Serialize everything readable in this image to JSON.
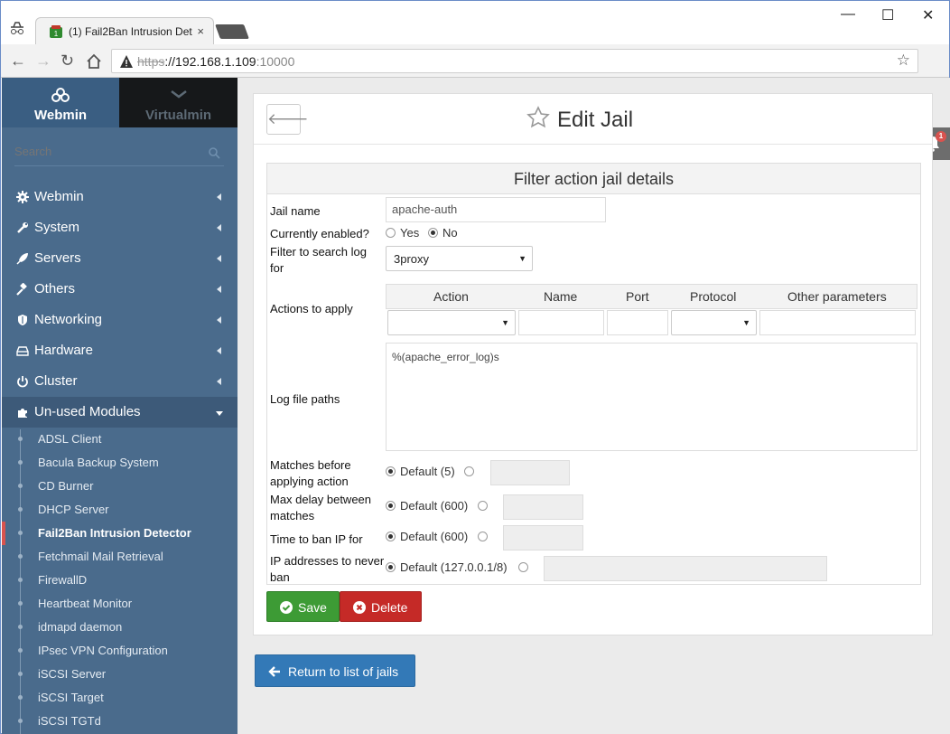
{
  "browser": {
    "tab_title": "(1) Fail2Ban Intrusion Det",
    "tab_close": "×",
    "url_struck": "https",
    "url_host": "://192.168.1.109",
    "url_port": ":10000"
  },
  "sidebar": {
    "tabs": [
      {
        "label": "Webmin"
      },
      {
        "label": "Virtualmin"
      }
    ],
    "search_placeholder": "Search",
    "categories": [
      {
        "label": "Webmin"
      },
      {
        "label": "System"
      },
      {
        "label": "Servers"
      },
      {
        "label": "Others"
      },
      {
        "label": "Networking"
      },
      {
        "label": "Hardware"
      },
      {
        "label": "Cluster"
      },
      {
        "label": "Un-used Modules"
      }
    ],
    "modules": [
      {
        "label": "ADSL Client"
      },
      {
        "label": "Bacula Backup System"
      },
      {
        "label": "CD Burner"
      },
      {
        "label": "DHCP Server"
      },
      {
        "label": "Fail2Ban Intrusion Detector"
      },
      {
        "label": "Fetchmail Mail Retrieval"
      },
      {
        "label": "FirewallD"
      },
      {
        "label": "Heartbeat Monitor"
      },
      {
        "label": "idmapd daemon"
      },
      {
        "label": "IPsec VPN Configuration"
      },
      {
        "label": "iSCSI Server"
      },
      {
        "label": "iSCSI Target"
      },
      {
        "label": "iSCSI TGTd"
      }
    ]
  },
  "page": {
    "title": "Edit Jail",
    "notification_count": "1",
    "form_title": "Filter action jail details",
    "jail_name_label": "Jail name",
    "jail_name_value": "apache-auth",
    "enabled_label": "Currently enabled?",
    "enabled_yes": "Yes",
    "enabled_no": "No",
    "filter_label": "Filter to search log for",
    "filter_value": "3proxy",
    "actions_label": "Actions to apply",
    "actions_columns": [
      "Action",
      "Name",
      "Port",
      "Protocol",
      "Other parameters"
    ],
    "logpaths_label": "Log file paths",
    "logpaths_value": "%(apache_error_log)s",
    "matches_label": "Matches before applying action",
    "matches_default": "Default (5)",
    "maxdelay_label": "Max delay between matches",
    "maxdelay_default": "Default (600)",
    "bantime_label": "Time to ban IP for",
    "bantime_default": "Default (600)",
    "ignoreip_label": "IP addresses to never ban",
    "ignoreip_default": "Default (127.0.0.1/8)",
    "save_label": "Save",
    "delete_label": "Delete",
    "return_label": "Return to list of jails"
  }
}
